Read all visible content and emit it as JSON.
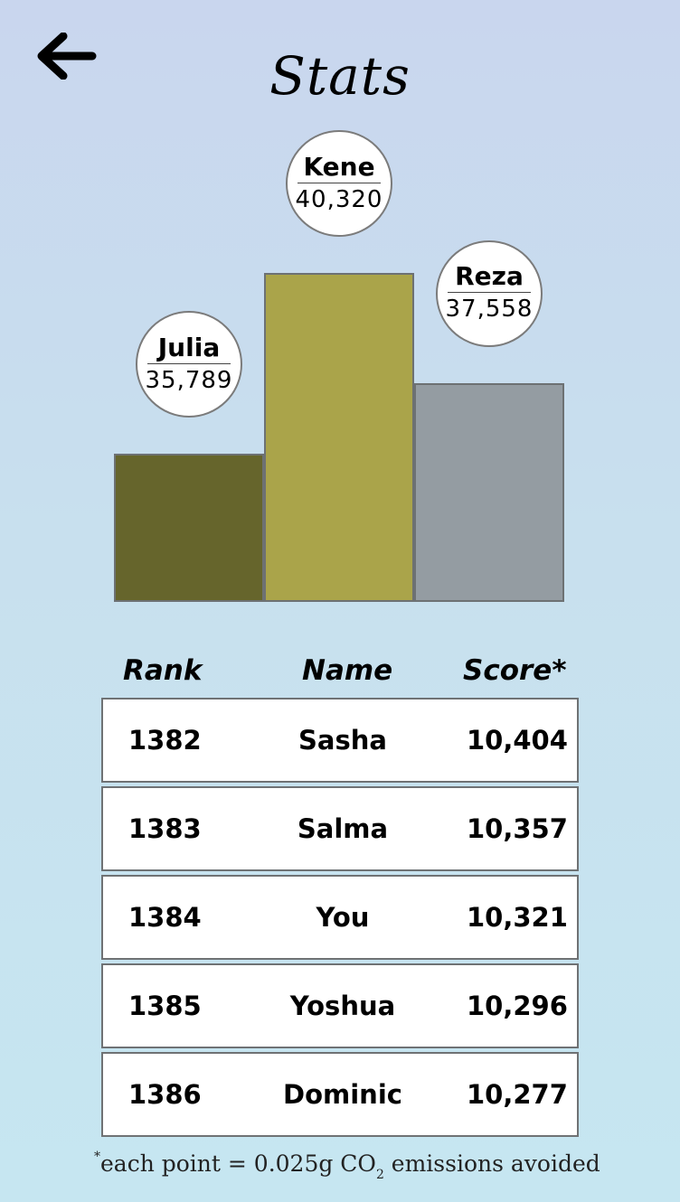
{
  "header": {
    "back_icon": "arrow-left-icon",
    "title": "Stats"
  },
  "podium": [
    {
      "name": "Julia",
      "score": "35,789",
      "value": 35789,
      "color": "#66652c"
    },
    {
      "name": "Kene",
      "score": "40,320",
      "value": 40320,
      "color": "#aaa44a"
    },
    {
      "name": "Reza",
      "score": "37,558",
      "value": 37558,
      "color": "#949ca2"
    }
  ],
  "table": {
    "headers": {
      "rank": "Rank",
      "name": "Name",
      "score": "Score*"
    },
    "rows": [
      {
        "rank": "1382",
        "name": "Sasha",
        "score": "10,404"
      },
      {
        "rank": "1383",
        "name": "Salma",
        "score": "10,357"
      },
      {
        "rank": "1384",
        "name": "You",
        "score": "10,321"
      },
      {
        "rank": "1385",
        "name": "Yoshua",
        "score": "10,296"
      },
      {
        "rank": "1386",
        "name": "Dominic",
        "score": "10,277"
      }
    ]
  },
  "footnote": {
    "prefix": "*",
    "text_before": "each point = 0.025g CO",
    "subscript": "2",
    "text_after": " emissions avoided"
  }
}
